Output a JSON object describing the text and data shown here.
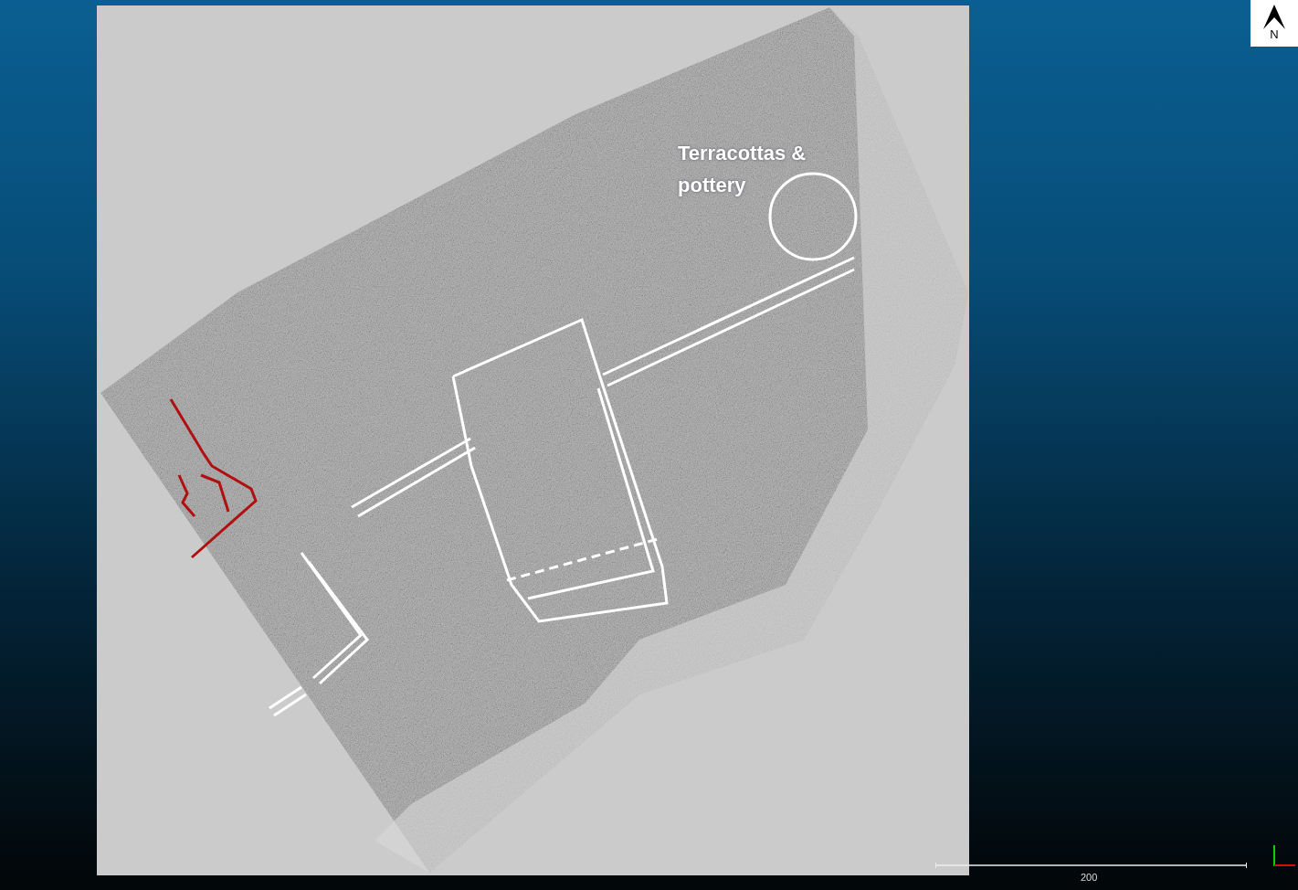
{
  "map_annotation": {
    "text": "Terracottas & pottery"
  },
  "north_arrow": {
    "label": "N"
  },
  "scale_bar": {
    "label": "200"
  }
}
